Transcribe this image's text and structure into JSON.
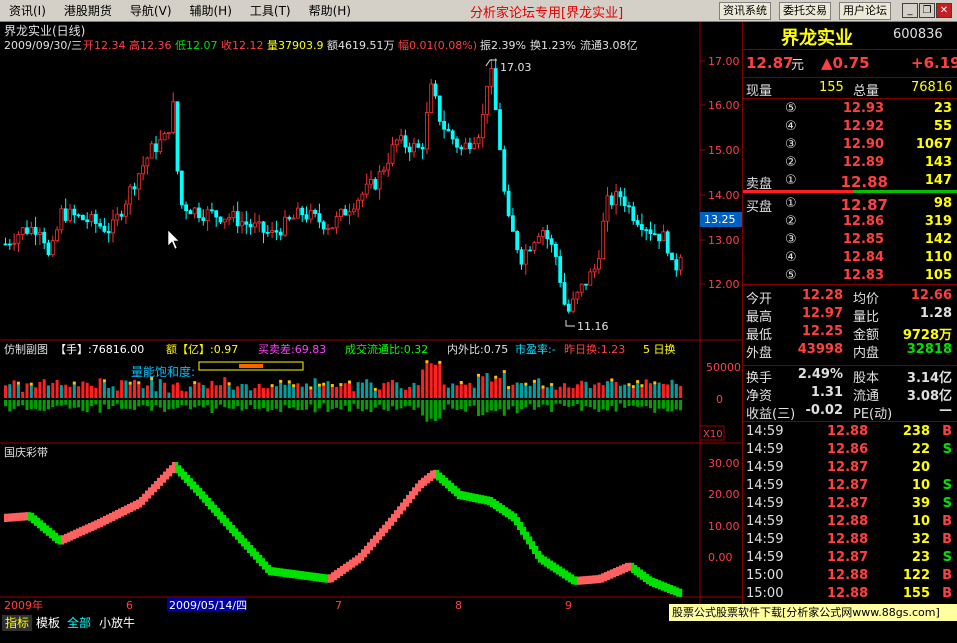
{
  "menubar": {
    "items": [
      "资讯(I)",
      "港股期货",
      "导航(V)",
      "辅助(H)",
      "工具(T)",
      "帮助(H)"
    ],
    "center_title": "分析家论坛专用[界龙实业]",
    "buttons": [
      "资讯系统",
      "委托交易",
      "用户论坛"
    ]
  },
  "main_chart": {
    "title": "界龙实业(日线)",
    "info": {
      "date": "2009/09/30/三",
      "open": "开12.34",
      "high": "高12.36",
      "low": "低12.07",
      "close": "收12.12",
      "volume": "量37903.9",
      "amount": "额4619.51万",
      "range": "幅0.01(0.08%)",
      "amplitude": "振2.39%",
      "turnover": "换1.23%",
      "float": "流通3.08亿"
    },
    "high_mark": "17.03",
    "low_mark": "11.16",
    "current_price": "13.25",
    "y_labels": [
      "17.00",
      "16.00",
      "15.00",
      "14.00",
      "13.00",
      "12.00"
    ]
  },
  "vol_panel": {
    "title": "仿制副图",
    "items": [
      {
        "label": "【手】:76816.00",
        "color": "#ffffff"
      },
      {
        "label": "额【亿】:0.97",
        "color": "#ffff00"
      },
      {
        "label": "买卖差:69.83",
        "color": "#ff40ff"
      },
      {
        "label": "成交流通比:0.32",
        "color": "#00ff00"
      },
      {
        "label": "内外比:0.75",
        "color": "#e0e0e0"
      },
      {
        "label": "市盈率:-",
        "color": "#00e0ff"
      },
      {
        "label": "昨日换:1.23",
        "color": "#ff4040"
      },
      {
        "label": "5 日换",
        "color": "#ffff00"
      }
    ],
    "saturation_label": "量能饱和度:",
    "y_labels": [
      "50000",
      "0"
    ],
    "scale": "X10"
  },
  "band_panel": {
    "title": "国庆彩带",
    "y_labels": [
      "30.00",
      "20.00",
      "10.00",
      "0.00"
    ]
  },
  "time_axis": {
    "labels": [
      "2009年",
      "6",
      "7",
      "8",
      "9"
    ],
    "cursor_date": "2009/05/14/四"
  },
  "quote": {
    "name": "界龙实业",
    "code": "600836",
    "price": "12.87",
    "unit": "元",
    "change": "▲0.75",
    "pct": "+6.19",
    "xianliang_label": "现量",
    "xianliang": "155",
    "zongliang_label": "总量",
    "zongliang": "76816",
    "sell_label": "卖盘",
    "buy_label": "买盘",
    "sells": [
      {
        "lvl": "⑤",
        "price": "12.93",
        "vol": "23"
      },
      {
        "lvl": "④",
        "price": "12.92",
        "vol": "55"
      },
      {
        "lvl": "③",
        "price": "12.90",
        "vol": "1067"
      },
      {
        "lvl": "②",
        "price": "12.89",
        "vol": "143"
      },
      {
        "lvl": "①",
        "price": "12.88",
        "vol": "147"
      }
    ],
    "buys": [
      {
        "lvl": "①",
        "price": "12.87",
        "vol": "98"
      },
      {
        "lvl": "②",
        "price": "12.86",
        "vol": "319"
      },
      {
        "lvl": "③",
        "price": "12.85",
        "vol": "142"
      },
      {
        "lvl": "④",
        "price": "12.84",
        "vol": "110"
      },
      {
        "lvl": "⑤",
        "price": "12.83",
        "vol": "105"
      }
    ],
    "stats": [
      [
        "今开",
        "12.28",
        "均价",
        "12.66"
      ],
      [
        "最高",
        "12.97",
        "量比",
        "1.28"
      ],
      [
        "最低",
        "12.25",
        "金额",
        "9728万"
      ],
      [
        "外盘",
        "43998",
        "内盘",
        "32818"
      ]
    ],
    "stats2": [
      [
        "换手",
        "2.49%",
        "股本",
        "3.14亿"
      ],
      [
        "净资",
        "1.31",
        "流通",
        "3.08亿"
      ],
      [
        "收益(三)",
        "-0.02",
        "PE(动)",
        "—"
      ]
    ],
    "ticks": [
      [
        "14:59",
        "12.88",
        "238",
        "B"
      ],
      [
        "14:59",
        "12.86",
        "22",
        "S"
      ],
      [
        "14:59",
        "12.87",
        "20",
        ""
      ],
      [
        "14:59",
        "12.87",
        "10",
        "S"
      ],
      [
        "14:59",
        "12.87",
        "39",
        "S"
      ],
      [
        "14:59",
        "12.88",
        "10",
        "B"
      ],
      [
        "14:59",
        "12.88",
        "32",
        "B"
      ],
      [
        "14:59",
        "12.87",
        "23",
        "S"
      ],
      [
        "15:00",
        "12.88",
        "122",
        "B"
      ],
      [
        "15:00",
        "12.88",
        "155",
        "B"
      ]
    ]
  },
  "bottom_tabs": [
    "指标",
    "模板",
    "全部",
    "小放牛"
  ],
  "ad": "股票公式股票软件下载[分析家公式网www.88gs.com]"
}
